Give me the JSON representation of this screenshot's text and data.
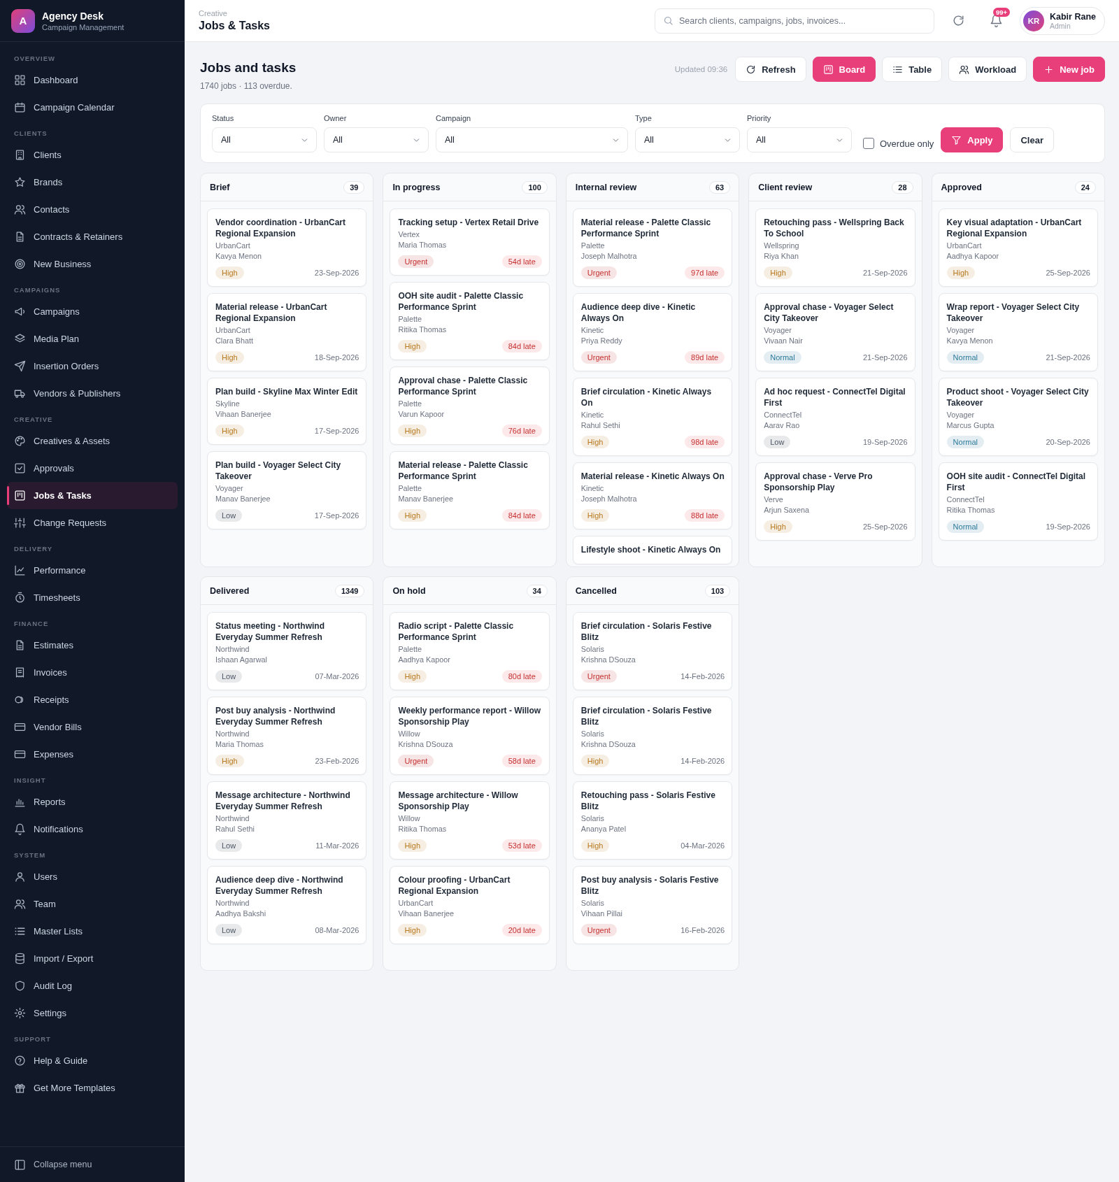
{
  "sidebar": {
    "brand": {
      "logo_letter": "A",
      "name": "Agency Desk",
      "tagline": "Campaign Management"
    },
    "sections": [
      {
        "label": "OVERVIEW",
        "items": [
          {
            "label": "Dashboard",
            "selected": false
          },
          {
            "label": "Campaign Calendar",
            "selected": false
          }
        ]
      },
      {
        "label": "CLIENTS",
        "items": [
          {
            "label": "Clients",
            "selected": false
          },
          {
            "label": "Brands",
            "selected": false
          },
          {
            "label": "Contacts",
            "selected": false
          },
          {
            "label": "Contracts & Retainers",
            "selected": false
          },
          {
            "label": "New Business",
            "selected": false
          }
        ]
      },
      {
        "label": "CAMPAIGNS",
        "items": [
          {
            "label": "Campaigns",
            "selected": false
          },
          {
            "label": "Media Plan",
            "selected": false
          },
          {
            "label": "Insertion Orders",
            "selected": false
          },
          {
            "label": "Vendors & Publishers",
            "selected": false
          }
        ]
      },
      {
        "label": "CREATIVE",
        "items": [
          {
            "label": "Creatives & Assets",
            "selected": false
          },
          {
            "label": "Approvals",
            "selected": false
          },
          {
            "label": "Jobs & Tasks",
            "selected": true
          },
          {
            "label": "Change Requests",
            "selected": false
          }
        ]
      },
      {
        "label": "DELIVERY",
        "items": [
          {
            "label": "Performance",
            "selected": false
          },
          {
            "label": "Timesheets",
            "selected": false
          }
        ]
      },
      {
        "label": "FINANCE",
        "items": [
          {
            "label": "Estimates",
            "selected": false
          },
          {
            "label": "Invoices",
            "selected": false
          },
          {
            "label": "Receipts",
            "selected": false
          },
          {
            "label": "Vendor Bills",
            "selected": false
          },
          {
            "label": "Expenses",
            "selected": false
          }
        ]
      },
      {
        "label": "INSIGHT",
        "items": [
          {
            "label": "Reports",
            "selected": false
          },
          {
            "label": "Notifications",
            "selected": false
          }
        ]
      },
      {
        "label": "SYSTEM",
        "items": [
          {
            "label": "Users",
            "selected": false
          },
          {
            "label": "Team",
            "selected": false
          },
          {
            "label": "Master Lists",
            "selected": false
          },
          {
            "label": "Import / Export",
            "selected": false
          },
          {
            "label": "Audit Log",
            "selected": false
          },
          {
            "label": "Settings",
            "selected": false
          }
        ]
      },
      {
        "label": "SUPPORT",
        "items": [
          {
            "label": "Help & Guide",
            "selected": false
          },
          {
            "label": "Get More Templates",
            "selected": false
          }
        ]
      }
    ],
    "collapse": "Collapse menu"
  },
  "header": {
    "breadcrumb": "Creative",
    "title": "Jobs & Tasks",
    "search": {
      "placeholder": "Search clients, campaigns, jobs, invoices..."
    },
    "notification_badge": "99+",
    "user": {
      "initials": "KR",
      "name": "Kabir Rane",
      "role": "Admin"
    }
  },
  "page": {
    "title": "Jobs and tasks",
    "subtitle": "1740 jobs · 113 overdue.",
    "updated": "Updated 09:36",
    "refresh": "Refresh",
    "views": [
      {
        "label": "Board",
        "selected": true
      },
      {
        "label": "Table",
        "selected": false
      },
      {
        "label": "Workload",
        "selected": false
      }
    ],
    "new_job": "New job"
  },
  "filters": {
    "selects": [
      {
        "label": "Status",
        "value": "All"
      },
      {
        "label": "Owner",
        "value": "All"
      },
      {
        "label": "Campaign",
        "value": "All"
      },
      {
        "label": "Type",
        "value": "All"
      },
      {
        "label": "Priority",
        "value": "All"
      }
    ],
    "overdue_only": {
      "label": "Overdue only",
      "checked": false
    },
    "apply": "Apply",
    "clear": "Clear"
  },
  "board": {
    "columns": [
      {
        "title": "Brief",
        "count": "39",
        "cards": [
          {
            "title": "Vendor coordination - UrbanCart Regional Expansion",
            "client": "UrbanCart",
            "owner": "Kavya Menon",
            "priority": "High",
            "color": "#b7791f",
            "due": "23-Sep-2026",
            "overdue": false
          },
          {
            "title": "Material release - UrbanCart Regional Expansion",
            "client": "UrbanCart",
            "owner": "Clara Bhatt",
            "priority": "High",
            "color": "#b7791f",
            "due": "18-Sep-2026",
            "overdue": false
          },
          {
            "title": "Plan build - Skyline Max Winter Edit",
            "client": "Skyline",
            "owner": "Vihaan Banerjee",
            "priority": "High",
            "color": "#b7791f",
            "due": "17-Sep-2026",
            "overdue": false
          },
          {
            "title": "Plan build - Voyager Select City Takeover",
            "client": "Voyager",
            "owner": "Manav Banerjee",
            "priority": "Low",
            "color": "#4b5563",
            "due": "17-Sep-2026",
            "overdue": false
          }
        ]
      },
      {
        "title": "In progress",
        "count": "100",
        "cards": [
          {
            "title": "Tracking setup - Vertex Retail Drive",
            "client": "Vertex",
            "owner": "Maria Thomas",
            "priority": "Urgent",
            "color": "#c53030",
            "due": "54d late",
            "overdue": true
          },
          {
            "title": "OOH site audit - Palette Classic Performance Sprint",
            "client": "Palette",
            "owner": "Ritika Thomas",
            "priority": "High",
            "color": "#b7791f",
            "due": "84d late",
            "overdue": true
          },
          {
            "title": "Approval chase - Palette Classic Performance Sprint",
            "client": "Palette",
            "owner": "Varun Kapoor",
            "priority": "High",
            "color": "#b7791f",
            "due": "76d late",
            "overdue": true
          },
          {
            "title": "Material release - Palette Classic Performance Sprint",
            "client": "Palette",
            "owner": "Manav Banerjee",
            "priority": "High",
            "color": "#b7791f",
            "due": "84d late",
            "overdue": true
          }
        ]
      },
      {
        "title": "Internal review",
        "count": "63",
        "cards": [
          {
            "title": "Material release - Palette Classic Performance Sprint",
            "client": "Palette",
            "owner": "Joseph Malhotra",
            "priority": "Urgent",
            "color": "#c53030",
            "due": "97d late",
            "overdue": true
          },
          {
            "title": "Audience deep dive - Kinetic Always On",
            "client": "Kinetic",
            "owner": "Priya Reddy",
            "priority": "Urgent",
            "color": "#c53030",
            "due": "89d late",
            "overdue": true
          },
          {
            "title": "Brief circulation - Kinetic Always On",
            "client": "Kinetic",
            "owner": "Rahul Sethi",
            "priority": "High",
            "color": "#b7791f",
            "due": "98d late",
            "overdue": true
          },
          {
            "title": "Material release - Kinetic Always On",
            "client": "Kinetic",
            "owner": "Joseph Malhotra",
            "priority": "High",
            "color": "#b7791f",
            "due": "88d late",
            "overdue": true
          },
          {
            "title": "Lifestyle shoot - Kinetic Always On"
          }
        ]
      },
      {
        "title": "Client review",
        "count": "28",
        "cards": [
          {
            "title": "Retouching pass - Wellspring Back To School",
            "client": "Wellspring",
            "owner": "Riya Khan",
            "priority": "High",
            "color": "#b7791f",
            "due": "21-Sep-2026",
            "overdue": false
          },
          {
            "title": "Approval chase - Voyager Select City Takeover",
            "client": "Voyager",
            "owner": "Vivaan Nair",
            "priority": "Normal",
            "color": "#2c7a9b",
            "due": "21-Sep-2026",
            "overdue": false
          },
          {
            "title": "Ad hoc request - ConnectTel Digital First",
            "client": "ConnectTel",
            "owner": "Aarav Rao",
            "priority": "Low",
            "color": "#4b5563",
            "due": "19-Sep-2026",
            "overdue": false
          },
          {
            "title": "Approval chase - Verve Pro Sponsorship Play",
            "client": "Verve",
            "owner": "Arjun Saxena",
            "priority": "High",
            "color": "#b7791f",
            "due": "25-Sep-2026",
            "overdue": false
          }
        ]
      },
      {
        "title": "Approved",
        "count": "24",
        "cards": [
          {
            "title": "Key visual adaptation - UrbanCart Regional Expansion",
            "client": "UrbanCart",
            "owner": "Aadhya Kapoor",
            "priority": "High",
            "color": "#b7791f",
            "due": "25-Sep-2026",
            "overdue": false
          },
          {
            "title": "Wrap report - Voyager Select City Takeover",
            "client": "Voyager",
            "owner": "Kavya Menon",
            "priority": "Normal",
            "color": "#2c7a9b",
            "due": "21-Sep-2026",
            "overdue": false
          },
          {
            "title": "Product shoot - Voyager Select City Takeover",
            "client": "Voyager",
            "owner": "Marcus Gupta",
            "priority": "Normal",
            "color": "#2c7a9b",
            "due": "20-Sep-2026",
            "overdue": false
          },
          {
            "title": "OOH site audit - ConnectTel Digital First",
            "client": "ConnectTel",
            "owner": "Ritika Thomas",
            "priority": "Normal",
            "color": "#2c7a9b",
            "due": "19-Sep-2026",
            "overdue": false
          }
        ]
      },
      {
        "title": "Delivered",
        "count": "1349",
        "cards": [
          {
            "title": "Status meeting - Northwind Everyday Summer Refresh",
            "client": "Northwind",
            "owner": "Ishaan Agarwal",
            "priority": "Low",
            "color": "#4b5563",
            "due": "07-Mar-2026",
            "overdue": false
          },
          {
            "title": "Post buy analysis - Northwind Everyday Summer Refresh",
            "client": "Northwind",
            "owner": "Maria Thomas",
            "priority": "High",
            "color": "#b7791f",
            "due": "23-Feb-2026",
            "overdue": false
          },
          {
            "title": "Message architecture - Northwind Everyday Summer Refresh",
            "client": "Northwind",
            "owner": "Rahul Sethi",
            "priority": "Low",
            "color": "#4b5563",
            "due": "11-Mar-2026",
            "overdue": false
          },
          {
            "title": "Audience deep dive - Northwind Everyday Summer Refresh",
            "client": "Northwind",
            "owner": "Aadhya Bakshi",
            "priority": "Low",
            "color": "#4b5563",
            "due": "08-Mar-2026",
            "overdue": false
          }
        ]
      },
      {
        "title": "On hold",
        "count": "34",
        "cards": [
          {
            "title": "Radio script - Palette Classic Performance Sprint",
            "client": "Palette",
            "owner": "Aadhya Kapoor",
            "priority": "High",
            "color": "#b7791f",
            "due": "80d late",
            "overdue": true
          },
          {
            "title": "Weekly performance report - Willow Sponsorship Play",
            "client": "Willow",
            "owner": "Krishna DSouza",
            "priority": "Urgent",
            "color": "#c53030",
            "due": "58d late",
            "overdue": true
          },
          {
            "title": "Message architecture - Willow Sponsorship Play",
            "client": "Willow",
            "owner": "Ritika Thomas",
            "priority": "High",
            "color": "#b7791f",
            "due": "53d late",
            "overdue": true
          },
          {
            "title": "Colour proofing - UrbanCart Regional Expansion",
            "client": "UrbanCart",
            "owner": "Vihaan Banerjee",
            "priority": "High",
            "color": "#b7791f",
            "due": "20d late",
            "overdue": true
          }
        ]
      },
      {
        "title": "Cancelled",
        "count": "103",
        "cards": [
          {
            "title": "Brief circulation - Solaris Festive Blitz",
            "client": "Solaris",
            "owner": "Krishna DSouza",
            "priority": "Urgent",
            "color": "#c53030",
            "due": "14-Feb-2026",
            "overdue": false
          },
          {
            "title": "Brief circulation - Solaris Festive Blitz",
            "client": "Solaris",
            "owner": "Krishna DSouza",
            "priority": "High",
            "color": "#b7791f",
            "due": "14-Feb-2026",
            "overdue": false
          },
          {
            "title": "Retouching pass - Solaris Festive Blitz",
            "client": "Solaris",
            "owner": "Ananya Patel",
            "priority": "High",
            "color": "#b7791f",
            "due": "04-Mar-2026",
            "overdue": false
          },
          {
            "title": "Post buy analysis - Solaris Festive Blitz",
            "client": "Solaris",
            "owner": "Vihaan Pillai",
            "priority": "Urgent",
            "color": "#c53030",
            "due": "16-Feb-2026",
            "overdue": false
          }
        ]
      }
    ]
  }
}
